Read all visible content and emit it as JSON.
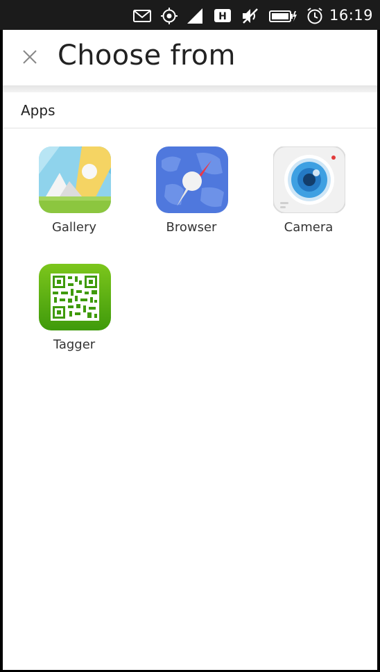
{
  "status_bar": {
    "time": "16:19",
    "network_badge": "H",
    "icons": [
      "mail-icon",
      "location-icon",
      "signal-icon",
      "network-h-icon",
      "muted-icon",
      "battery-charging-icon",
      "alarm-icon"
    ]
  },
  "header": {
    "title": "Choose from",
    "close_icon": "close-icon"
  },
  "section": {
    "title": "Apps"
  },
  "apps": [
    {
      "label": "Gallery",
      "icon": "gallery-icon"
    },
    {
      "label": "Browser",
      "icon": "browser-icon"
    },
    {
      "label": "Camera",
      "icon": "camera-icon"
    },
    {
      "label": "Tagger",
      "icon": "tagger-icon"
    }
  ],
  "colors": {
    "status_bar_bg": "#1b1b1b",
    "background": "#ffffff",
    "text": "#222222",
    "tagger_green": "#4ea60e",
    "browser_blue": "#4f78dd",
    "camera_blue": "#2f8fd6",
    "gallery_yellow": "#f5d463"
  }
}
